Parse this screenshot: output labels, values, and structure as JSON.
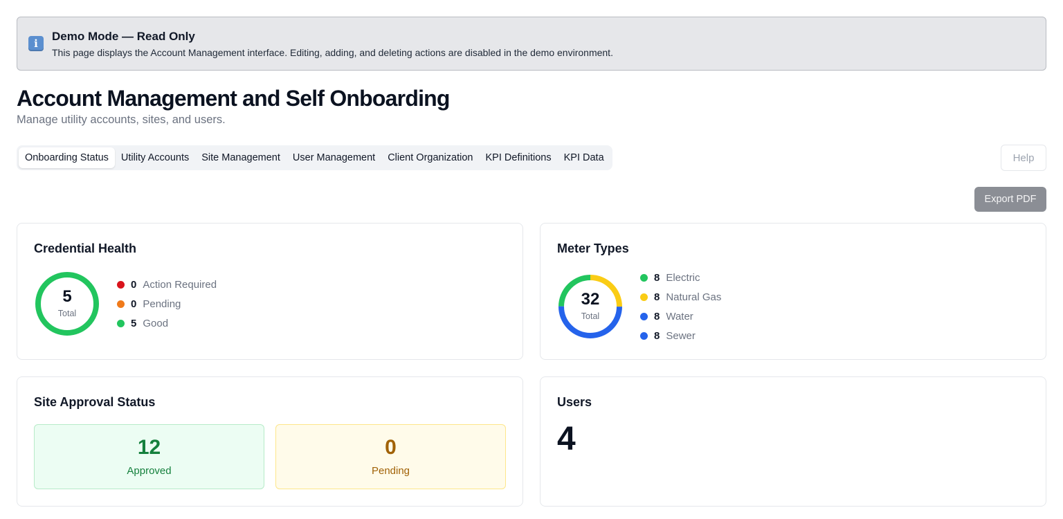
{
  "banner": {
    "icon": "info-icon",
    "title": "Demo Mode — Read Only",
    "text": "This page displays the Account Management interface. Editing, adding, and deleting actions are disabled in the demo environment."
  },
  "header": {
    "title": "Account Management and Self Onboarding",
    "subtitle": "Manage utility accounts, sites, and users."
  },
  "tabs": [
    {
      "label": "Onboarding Status",
      "active": true
    },
    {
      "label": "Utility Accounts"
    },
    {
      "label": "Site Management"
    },
    {
      "label": "User Management"
    },
    {
      "label": "Client Organization"
    },
    {
      "label": "KPI Definitions"
    },
    {
      "label": "KPI Data"
    }
  ],
  "toolbar": {
    "help_label": "Help",
    "export_label": "Export PDF"
  },
  "credential_health": {
    "title": "Credential Health",
    "total": "5",
    "total_label": "Total",
    "legend": [
      {
        "count": "0",
        "label": "Action Required",
        "color": "#d9141c"
      },
      {
        "count": "0",
        "label": "Pending",
        "color": "#f07a1a"
      },
      {
        "count": "5",
        "label": "Good",
        "color": "#22c55e"
      }
    ]
  },
  "meter_types": {
    "title": "Meter Types",
    "total": "32",
    "total_label": "Total",
    "legend": [
      {
        "count": "8",
        "label": "Electric",
        "color": "#22c55e"
      },
      {
        "count": "8",
        "label": "Natural Gas",
        "color": "#facc15"
      },
      {
        "count": "8",
        "label": "Water",
        "color": "#2563eb"
      },
      {
        "count": "8",
        "label": "Sewer",
        "color": "#2563eb"
      }
    ]
  },
  "site_approval": {
    "title": "Site Approval Status",
    "approved": {
      "value": "12",
      "label": "Approved",
      "text_color": "#15803d",
      "bg": "#ecfdf3",
      "border": "#b7ebc8"
    },
    "pending": {
      "value": "0",
      "label": "Pending",
      "text_color": "#a16207",
      "bg": "#fffbea",
      "border": "#fde68a"
    }
  },
  "users": {
    "title": "Users",
    "count": "4"
  }
}
